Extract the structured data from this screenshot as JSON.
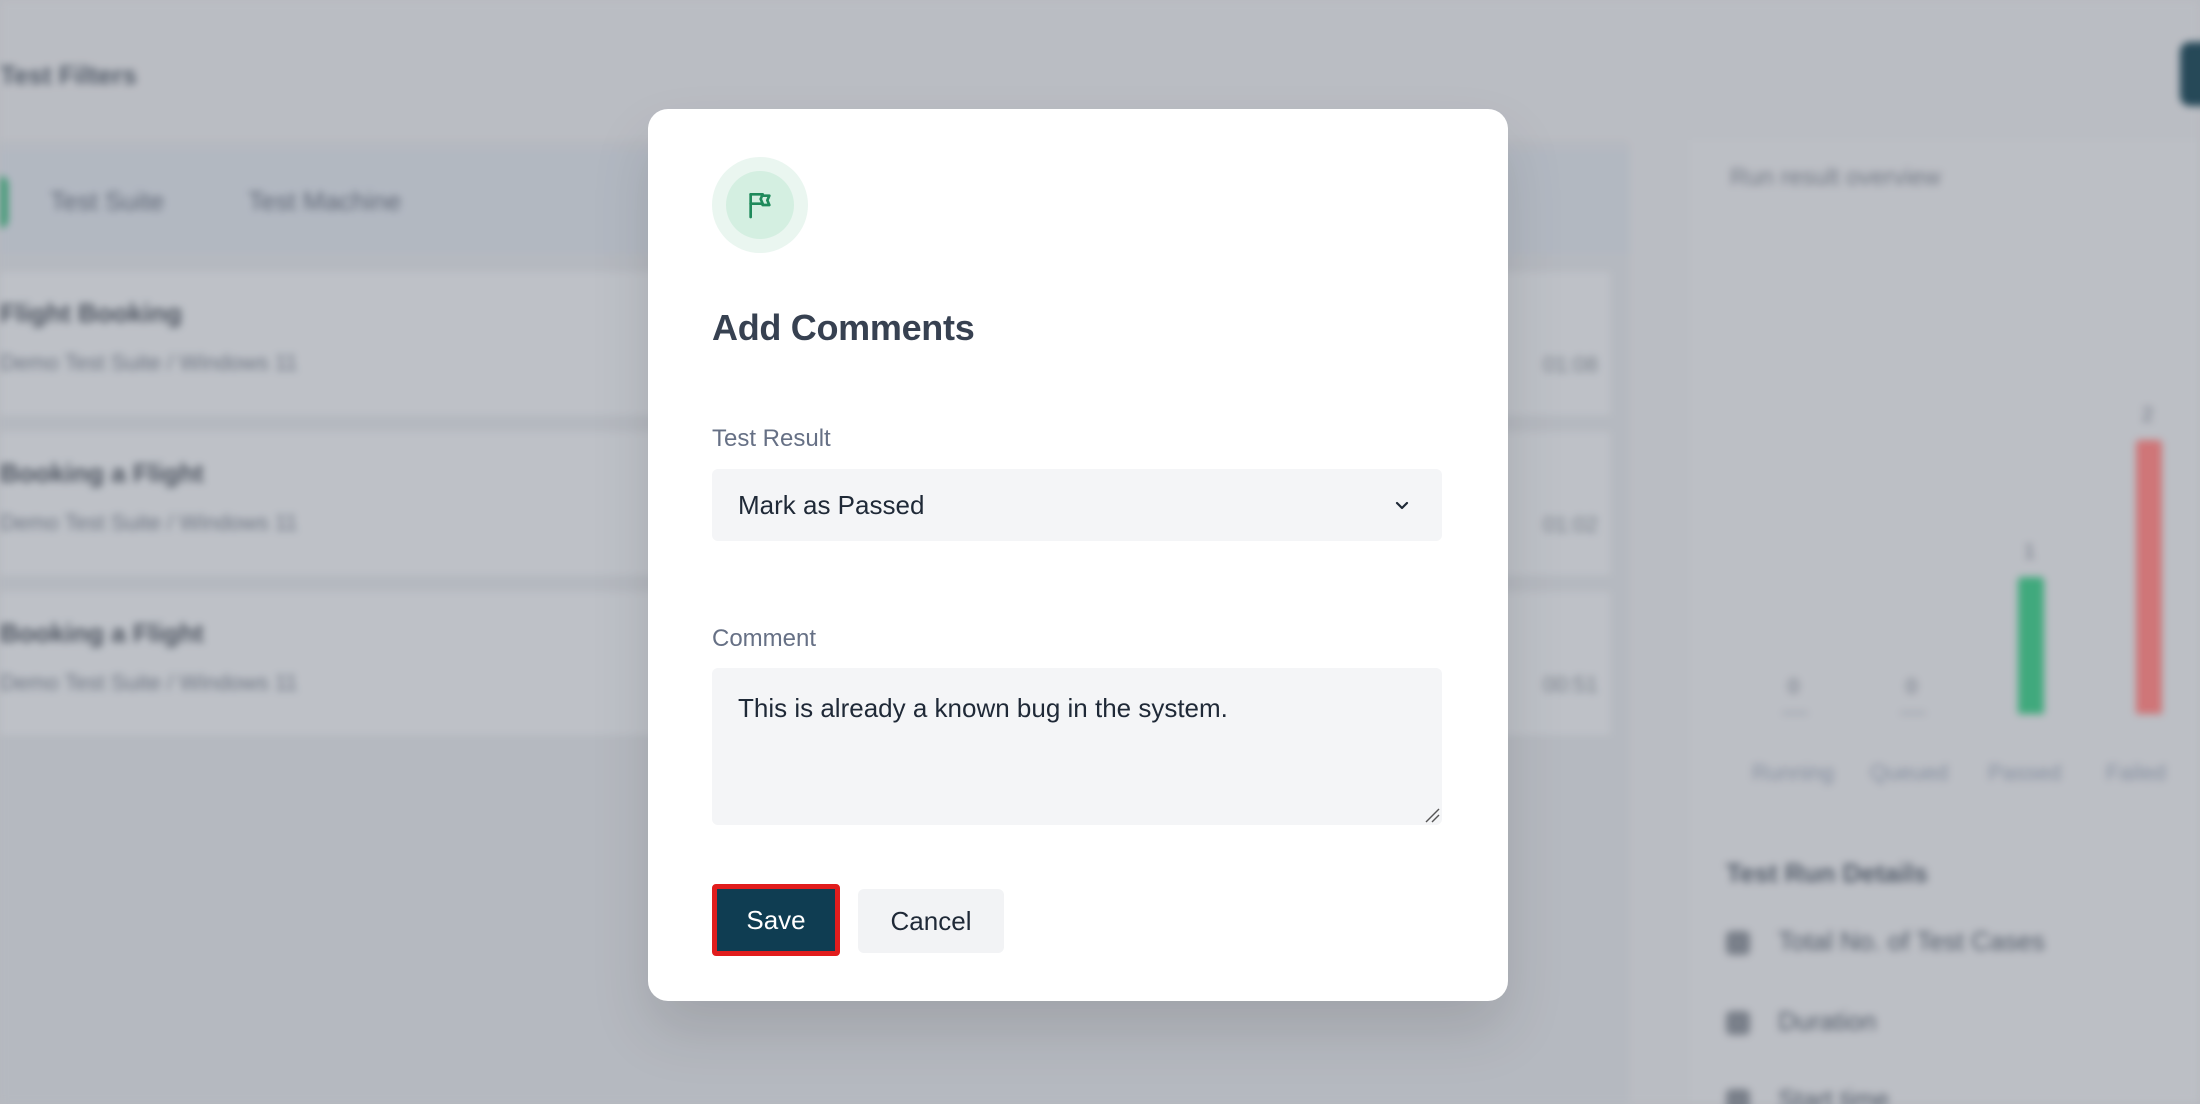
{
  "background": {
    "page_title": "Test Filters",
    "tabs": [
      {
        "label": "Test Suite"
      },
      {
        "label": "Test Machine"
      }
    ],
    "rows": [
      {
        "title": "Flight Booking",
        "subtitle": "Demo Test Suite / Windows 11",
        "time": "01:08"
      },
      {
        "title": "Booking a Flight",
        "subtitle": "Demo Test Suite / Windows 11",
        "time": "01:02"
      },
      {
        "title": "Booking a Flight",
        "subtitle": "Demo Test Suite / Windows 11",
        "time": "00:51"
      }
    ],
    "side_panel": {
      "heading": "Run result overview",
      "bars": [
        {
          "label": "Running",
          "value": "0",
          "fraction": 0,
          "color": "#9ca3af"
        },
        {
          "label": "Queued",
          "value": "0",
          "fraction": 0,
          "color": "#9ca3af"
        },
        {
          "label": "Passed",
          "value": "1",
          "fraction": 0.5,
          "color": "#34b37a"
        },
        {
          "label": "Failed",
          "value": "2",
          "fraction": 1,
          "color": "#e27474"
        }
      ],
      "details_title": "Test Run Details",
      "details": [
        {
          "label": "Total No. of Test Cases"
        },
        {
          "label": "Duration"
        },
        {
          "label": "Start time"
        }
      ]
    }
  },
  "modal": {
    "icon": "flag-icon",
    "title": "Add Comments",
    "test_result": {
      "label": "Test Result",
      "selected": "Mark as Passed"
    },
    "comment": {
      "label": "Comment",
      "value": "This is already a known bug in the system."
    },
    "buttons": {
      "save": "Save",
      "cancel": "Cancel"
    }
  },
  "colors": {
    "primary": "#0f3d52",
    "accent_green": "#1f8a5b",
    "highlight": "#e11d1d"
  }
}
